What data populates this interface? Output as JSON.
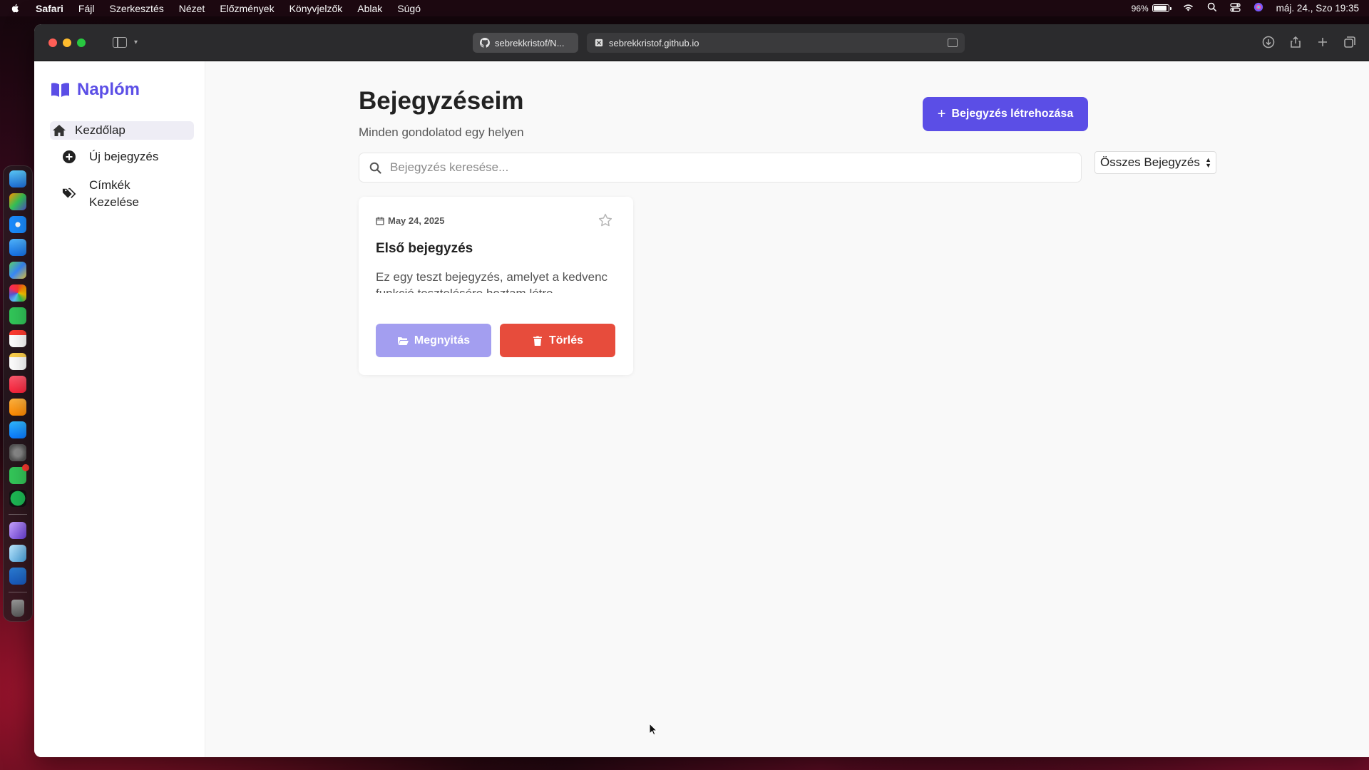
{
  "menubar": {
    "app_name": "Safari",
    "menus": [
      "Fájl",
      "Szerkesztés",
      "Nézet",
      "Előzmények",
      "Könyvjelzők",
      "Ablak",
      "Súgó"
    ],
    "battery": "96%",
    "datetime": "máj. 24., Szo 19:35"
  },
  "browser": {
    "tabs": [
      {
        "title": "sebrekkristof/N...",
        "icon": "github-icon"
      },
      {
        "title": "sebrekkristof.github.io",
        "icon": "site-favicon"
      }
    ]
  },
  "app": {
    "brand": "Naplóm",
    "nav": {
      "home": "Kezdőlap",
      "new_entry": "Új bejegyzés",
      "manage_tags": "Címkék Kezelése"
    },
    "page_title": "Bejegyzéseim",
    "page_subtitle": "Minden gondolatod egy helyen",
    "create_button": "Bejegyzés létrehozása",
    "search": {
      "placeholder": "Bejegyzés keresése...",
      "value": ""
    },
    "filter": {
      "selected": "Összes Bejegyzés"
    },
    "entries": [
      {
        "date": "May 24, 2025",
        "title": "Első bejegyzés",
        "excerpt": "Ez egy teszt bejegyzés, amelyet a kedvenc funkció tesztelésére hoztam létre.",
        "favorite": false,
        "open_label": "Megnyitás",
        "delete_label": "Törlés"
      }
    ]
  },
  "colors": {
    "accent": "#5b4ee6",
    "accent_light": "#a39ef0",
    "danger": "#e74c3c"
  }
}
